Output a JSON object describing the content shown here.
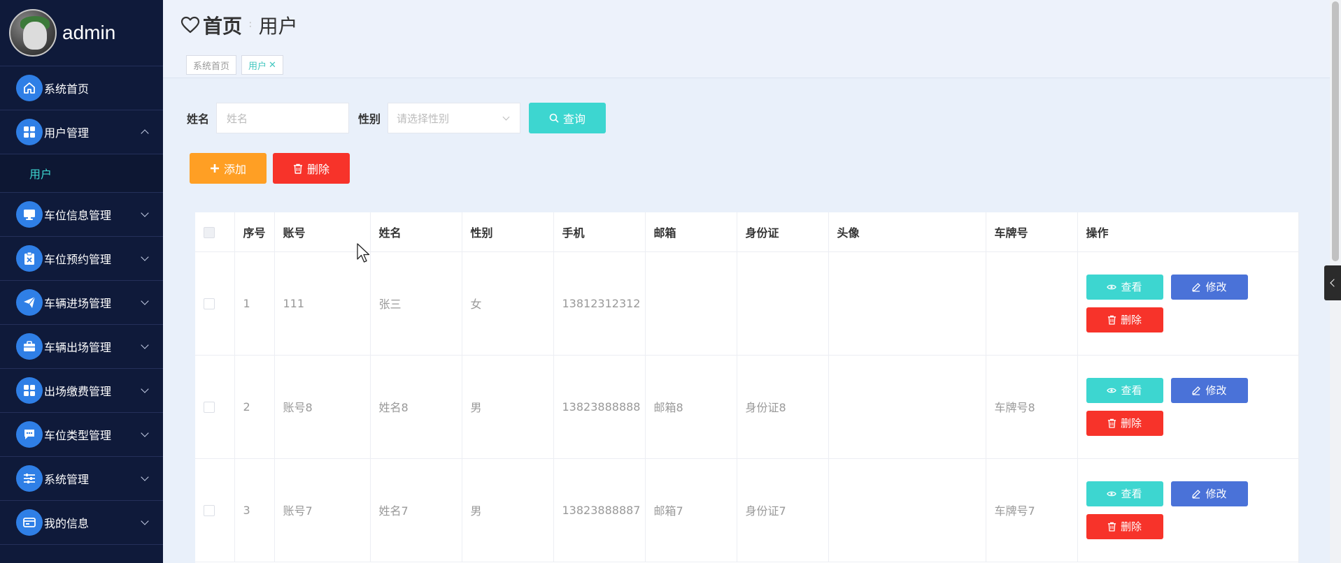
{
  "sidebar": {
    "username": "admin",
    "items": [
      {
        "label": "系统首页",
        "icon": "home-icon"
      },
      {
        "label": "用户管理",
        "icon": "grid-icon",
        "expanded": true,
        "children": [
          {
            "label": "用户"
          }
        ]
      },
      {
        "label": "车位信息管理",
        "icon": "monitor-icon"
      },
      {
        "label": "车位预约管理",
        "icon": "clipboard-icon"
      },
      {
        "label": "车辆进场管理",
        "icon": "send-icon"
      },
      {
        "label": "车辆出场管理",
        "icon": "briefcase-icon"
      },
      {
        "label": "出场缴费管理",
        "icon": "grid-icon"
      },
      {
        "label": "车位类型管理",
        "icon": "chat-icon"
      },
      {
        "label": "系统管理",
        "icon": "sliders-icon"
      },
      {
        "label": "我的信息",
        "icon": "card-icon"
      }
    ]
  },
  "header": {
    "breadcrumb_home": "首页",
    "breadcrumb_current": "用户",
    "tags": [
      {
        "label": "系统首页"
      },
      {
        "label": "用户",
        "active": true
      }
    ]
  },
  "search": {
    "name_label": "姓名",
    "name_placeholder": "姓名",
    "gender_label": "性别",
    "gender_placeholder": "请选择性别",
    "query_button": "查询"
  },
  "actions": {
    "add_button": "添加",
    "delete_button": "删除"
  },
  "table": {
    "columns": [
      "序号",
      "账号",
      "姓名",
      "性别",
      "手机",
      "邮箱",
      "身份证",
      "头像",
      "车牌号",
      "操作"
    ],
    "rows": [
      {
        "index": "1",
        "account": "111",
        "name": "张三",
        "gender": "女",
        "phone": "13812312312",
        "email": "",
        "id_card": "",
        "avatar": "",
        "plate": ""
      },
      {
        "index": "2",
        "account": "账号8",
        "name": "姓名8",
        "gender": "男",
        "phone": "13823888888",
        "email": "邮箱8",
        "id_card": "身份证8",
        "avatar": "",
        "plate": "车牌号8"
      },
      {
        "index": "3",
        "account": "账号7",
        "name": "姓名7",
        "gender": "男",
        "phone": "13823888887",
        "email": "邮箱7",
        "id_card": "身份证7",
        "avatar": "",
        "plate": "车牌号7"
      }
    ],
    "row_actions": {
      "view": "查看",
      "edit": "修改",
      "delete": "删除"
    }
  },
  "colors": {
    "sidebar_bg": "#0f1a3a",
    "menu_icon_bg": "#2f7fe6",
    "accent_teal": "#3dd6d0",
    "add_orange": "#ff9f24",
    "delete_red": "#f7332a",
    "edit_blue": "#4a72d8"
  }
}
